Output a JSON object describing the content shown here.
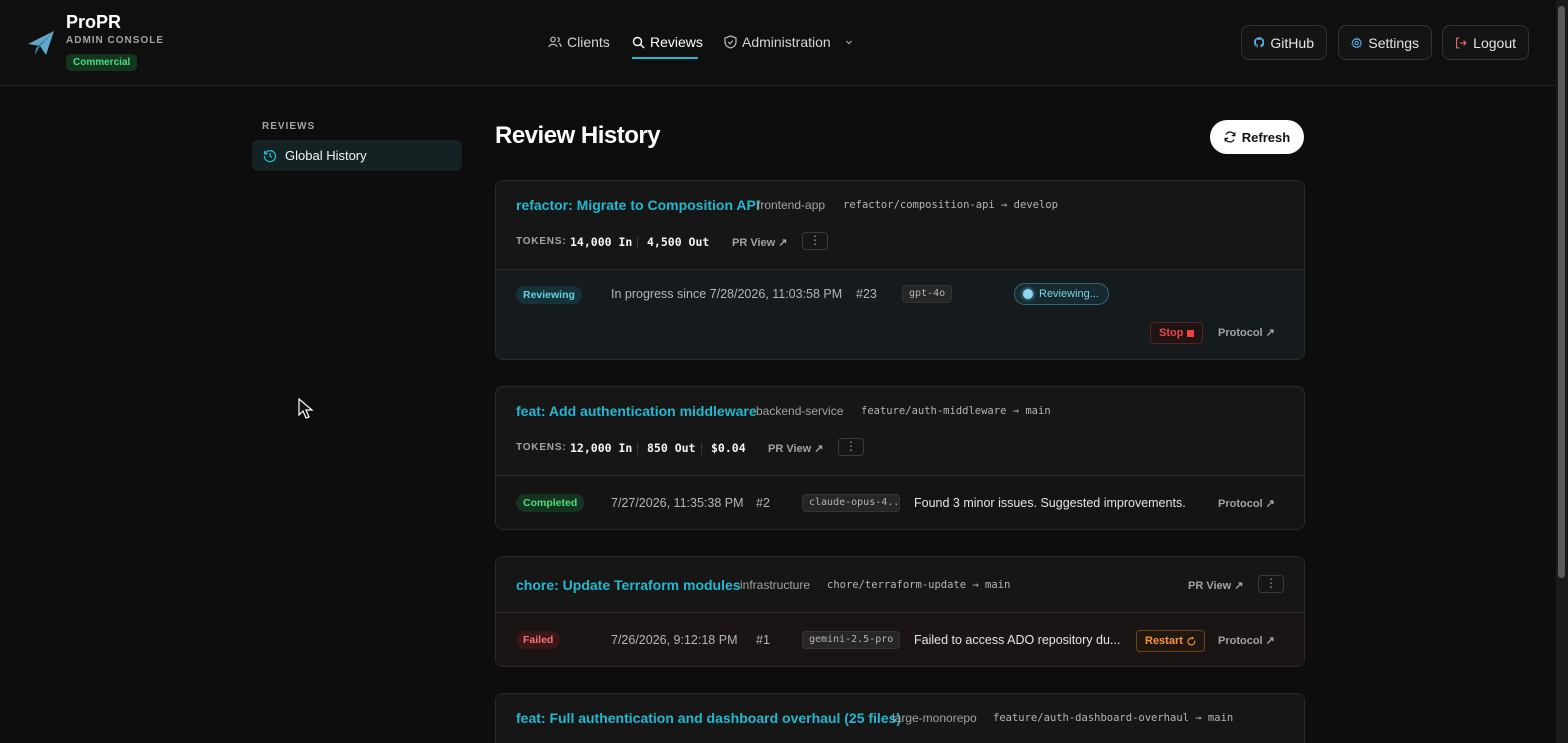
{
  "brand": {
    "name": "ProPR",
    "subtitle": "ADMIN CONSOLE",
    "badge": "Commercial"
  },
  "nav": {
    "clients": "Clients",
    "reviews": "Reviews",
    "administration": "Administration"
  },
  "header_actions": {
    "github": "GitHub",
    "settings": "Settings",
    "logout": "Logout"
  },
  "sidebar": {
    "section_title": "REVIEWS",
    "items": [
      {
        "label": "Global History"
      }
    ]
  },
  "main": {
    "title": "Review History",
    "refresh_label": "Refresh"
  },
  "labels": {
    "tokens": "TOKENS:",
    "pr_view": "PR View ↗",
    "protocol": "Protocol ↗",
    "stop": "Stop",
    "restart": "Restart",
    "reviewing_pill": "Reviewing...",
    "kebab": "⋮"
  },
  "reviews": [
    {
      "title": "refactor: Migrate to Composition API",
      "repo": "frontend-app",
      "branch": "refactor/composition-api → develop",
      "tokens_in": "14,000 In",
      "tokens_out": "4,500 Out",
      "status": "Reviewing",
      "timestamp": "In progress since 7/28/2026, 11:03:58 PM",
      "number": "#23",
      "model": "gpt-4o"
    },
    {
      "title": "feat: Add authentication middleware",
      "repo": "backend-service",
      "branch": "feature/auth-middleware → main",
      "tokens_in": "12,000 In",
      "tokens_out": "850 Out",
      "cost": "$0.04",
      "status": "Completed",
      "timestamp": "7/27/2026, 11:35:38 PM",
      "number": "#2",
      "model": "claude-opus-4...",
      "summary": "Found 3 minor issues. Suggested improvements."
    },
    {
      "title": "chore: Update Terraform modules",
      "repo": "infrastructure",
      "branch": "chore/terraform-update → main",
      "status": "Failed",
      "timestamp": "7/26/2026, 9:12:18 PM",
      "number": "#1",
      "model": "gemini-2.5-pro",
      "summary": "Failed to access ADO repository du..."
    },
    {
      "title": "feat: Full authentication and dashboard overhaul (25 files)",
      "repo": "large-monorepo",
      "branch": "feature/auth-dashboard-overhaul → main"
    }
  ],
  "colors": {
    "accent": "#22b8cf",
    "background": "#0d0d0d",
    "completed": "#4ade80",
    "failed": "#f87171",
    "warning": "#fb923c"
  }
}
